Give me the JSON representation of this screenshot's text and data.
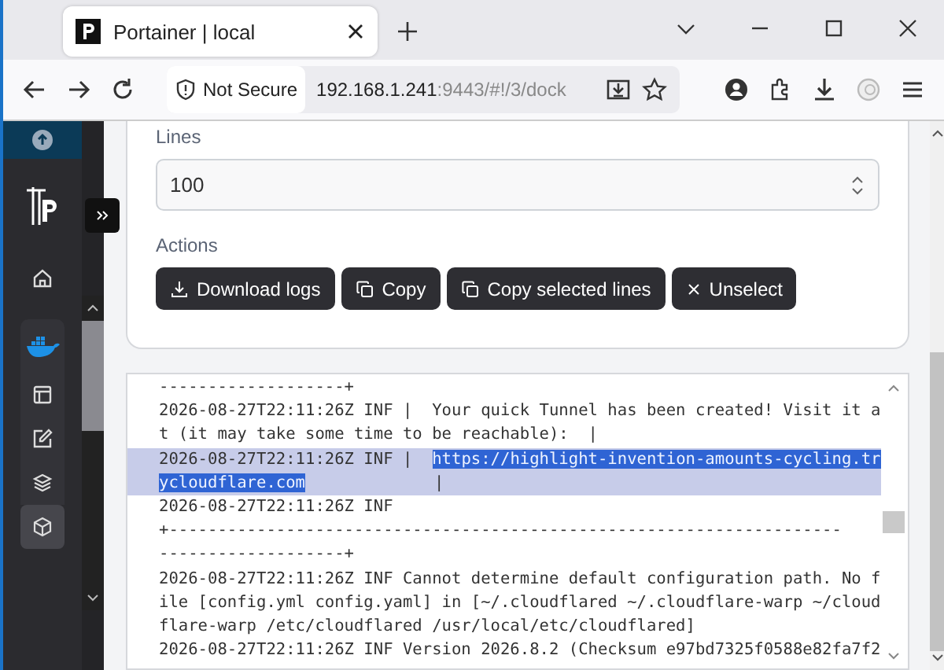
{
  "browser": {
    "tab_title": "Portainer | local",
    "security_label": "Not Secure",
    "url_host": "192.168.1.241",
    "url_rest": ":9443/#!/3/dock"
  },
  "sidebar": {
    "items": [
      {
        "kind": "home",
        "selected": false
      },
      {
        "kind": "docker",
        "selected": false
      },
      {
        "kind": "layout",
        "selected": false
      },
      {
        "kind": "edit",
        "selected": false
      },
      {
        "kind": "layers",
        "selected": false
      },
      {
        "kind": "cube",
        "selected": true
      }
    ]
  },
  "settings": {
    "lines_label": "Lines",
    "lines_value": "100",
    "actions_label": "Actions",
    "actions": [
      {
        "kind": "download",
        "label": "Download logs"
      },
      {
        "kind": "copy",
        "label": "Copy"
      },
      {
        "kind": "copy",
        "label": "Copy selected lines"
      },
      {
        "kind": "close",
        "label": "Unselect"
      }
    ]
  },
  "log": {
    "rows": [
      {
        "selected": false,
        "parts": [
          {
            "text": "-------------------+",
            "highlighted": false
          }
        ]
      },
      {
        "selected": false,
        "parts": [
          {
            "text": "2026-08-27T22:11:26Z INF |  Your quick Tunnel has been created! Visit it a",
            "highlighted": false
          }
        ]
      },
      {
        "selected": false,
        "parts": [
          {
            "text": "t (it may take some time to be reachable):  |",
            "highlighted": false
          }
        ]
      },
      {
        "selected": true,
        "parts": [
          {
            "text": "2026-08-27T22:11:26Z INF |  ",
            "highlighted": false
          },
          {
            "text": "https://highlight-invention-amounts-cycling.tr",
            "highlighted": true
          }
        ]
      },
      {
        "selected": true,
        "parts": [
          {
            "text": "ycloudflare.com",
            "highlighted": true
          },
          {
            "text": "|",
            "highlighted": false
          }
        ]
      },
      {
        "selected": false,
        "parts": [
          {
            "text": "2026-08-27T22:11:26Z INF",
            "highlighted": false
          }
        ]
      },
      {
        "selected": false,
        "parts": [
          {
            "text": "+---------------------------------------------------------------------",
            "highlighted": false
          }
        ]
      },
      {
        "selected": false,
        "parts": [
          {
            "text": "-------------------+",
            "highlighted": false
          }
        ]
      },
      {
        "selected": false,
        "parts": [
          {
            "text": "2026-08-27T22:11:26Z INF Cannot determine default configuration path. No f",
            "highlighted": false
          }
        ]
      },
      {
        "selected": false,
        "parts": [
          {
            "text": "ile [config.yml config.yaml] in [~/.cloudflared ~/.cloudflare-warp ~/cloud",
            "highlighted": false
          }
        ]
      },
      {
        "selected": false,
        "parts": [
          {
            "text": "flare-warp /etc/cloudflared /usr/local/etc/cloudflared]",
            "highlighted": false
          }
        ]
      },
      {
        "selected": false,
        "parts": [
          {
            "text": "2026-08-27T22:11:26Z INF Version 2026.8.2 (Checksum e97bd7325f0588e82fa7f2",
            "highlighted": false
          }
        ]
      }
    ]
  }
}
